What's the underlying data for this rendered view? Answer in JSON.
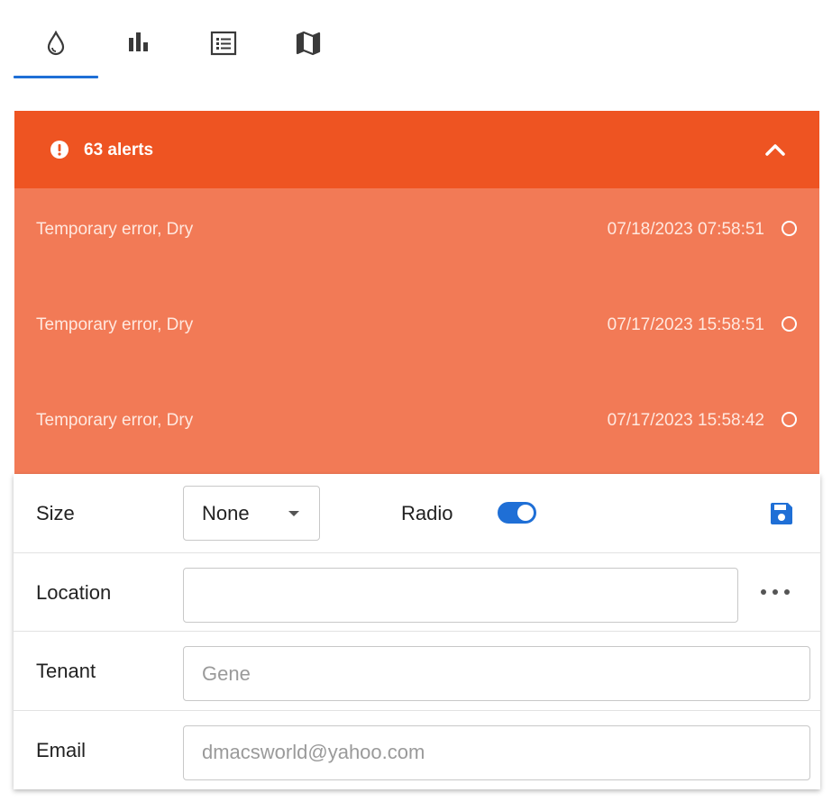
{
  "tabs": [
    {
      "icon": "water-drop-icon",
      "active": true
    },
    {
      "icon": "bar-chart-icon",
      "active": false
    },
    {
      "icon": "list-icon",
      "active": false
    },
    {
      "icon": "map-icon",
      "active": false
    }
  ],
  "alerts": {
    "title": "63 alerts",
    "header_color": "#ee5422",
    "items": [
      {
        "message": "Temporary error, Dry",
        "timestamp": "07/18/2023 07:58:51"
      },
      {
        "message": "Temporary error, Dry",
        "timestamp": "07/17/2023 15:58:51"
      },
      {
        "message": "Temporary error, Dry",
        "timestamp": "07/17/2023 15:58:42"
      }
    ]
  },
  "form": {
    "size_label": "Size",
    "size_value": "None",
    "radio_label": "Radio",
    "radio_enabled": true,
    "location_label": "Location",
    "location_value": "",
    "tenant_label": "Tenant",
    "tenant_placeholder": "Gene",
    "email_label": "Email",
    "email_placeholder": "dmacsworld@yahoo.com"
  },
  "colors": {
    "accent": "#1f6fd6",
    "alert_header": "#ee5422",
    "alert_body": "#f27a56"
  }
}
